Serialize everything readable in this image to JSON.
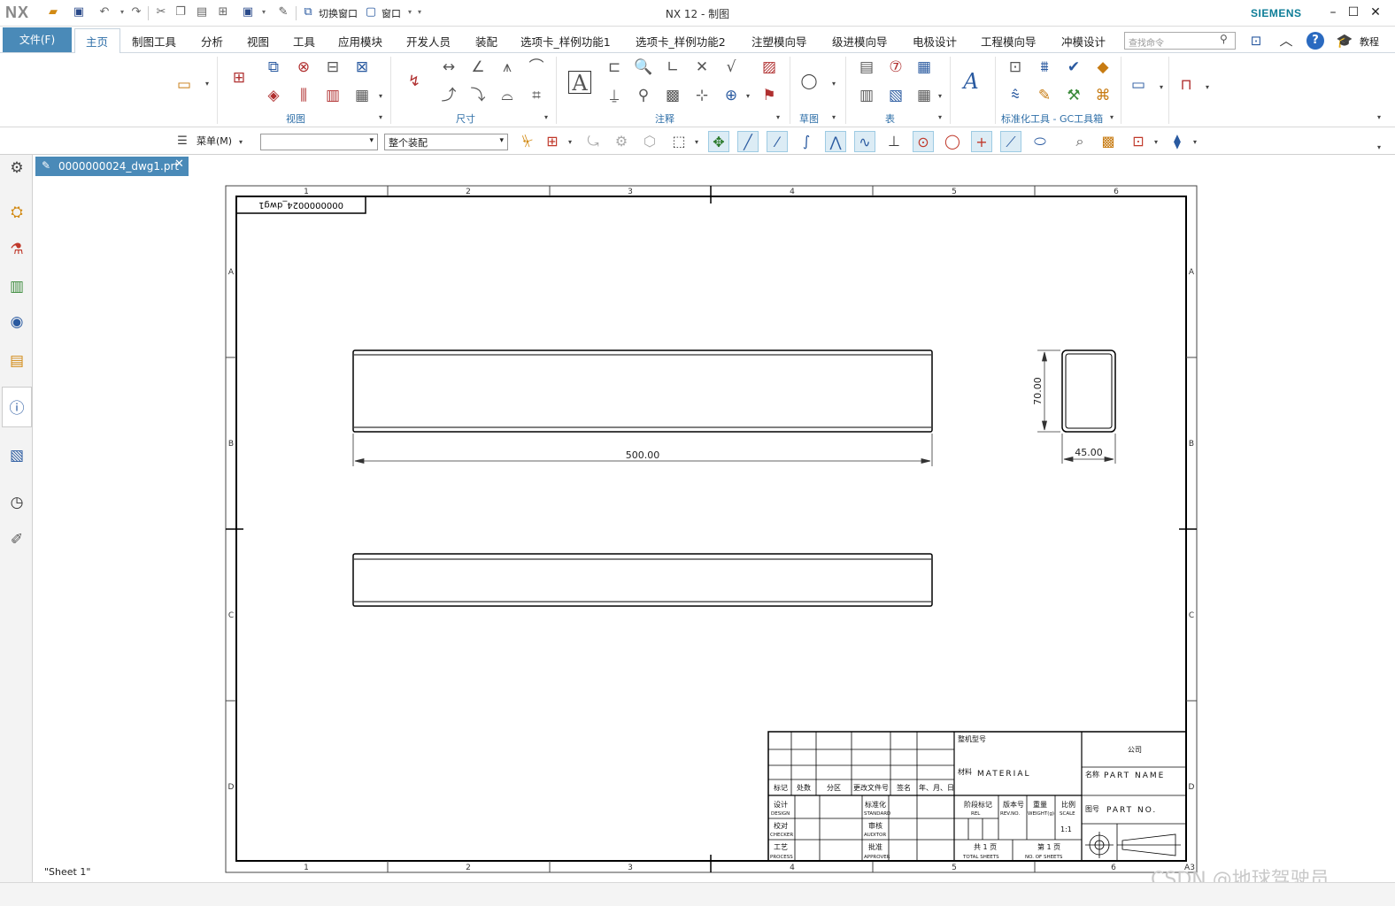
{
  "titlebar": {
    "logo": "NX",
    "switch_window": "切换窗口",
    "window_menu": "窗口",
    "app_title": "NX 12 - 制图",
    "brand": "SIEMENS"
  },
  "tabs": {
    "file": "文件(F)",
    "items": [
      "主页",
      "制图工具",
      "分析",
      "视图",
      "工具",
      "应用模块",
      "开发人员",
      "装配",
      "选项卡_样例功能1",
      "选项卡_样例功能2",
      "注塑模向导",
      "级进模向导",
      "电极设计",
      "工程模向导",
      "冲模设计"
    ],
    "search_placeholder": "查找命令",
    "tutorial": "教程"
  },
  "ribbon": {
    "groups": [
      "视图",
      "尺寸",
      "注释",
      "草图",
      "表",
      "标准化工具 - GC工具箱"
    ]
  },
  "selection_bar": {
    "menu": "菜单(M)",
    "filter_value": "",
    "scope_value": "整个装配"
  },
  "document": {
    "tab": "0000000024_dwg1.prt",
    "sheet_label": "\"Sheet 1\"",
    "watermark": "CSDN @地球驾驶员"
  },
  "drawing": {
    "corner_label": "0000000024_dwg1",
    "col_labels": [
      "1",
      "2",
      "3",
      "4",
      "5",
      "6"
    ],
    "row_labels": [
      "A",
      "B",
      "C",
      "D"
    ],
    "size_label": "A3",
    "dim_length": "500.00",
    "dim_height": "70.00",
    "dim_width": "45.00",
    "title_block": {
      "mark": "标记",
      "count": "处数",
      "zone": "分区",
      "change_doc": "更改文件号",
      "sign": "签名",
      "date": "年、月、日",
      "design": "设计",
      "design_en": "DESIGN",
      "checker": "校对",
      "checker_en": "CHECKER",
      "process": "工艺",
      "process_en": "PROCESS",
      "standard": "标准化",
      "standard_en": "STANDARD",
      "auditor": "审核",
      "auditor_en": "AUDITOR",
      "approver": "批准",
      "approver_en": "APPROVER",
      "model": "整机型号",
      "material": "材料",
      "material_en": "MATERIAL",
      "stage_mark": "阶段标记",
      "rel": "REL",
      "version": "版本号",
      "rev": "REV.NO.",
      "weight": "重量",
      "weight_en": "WEIGHT(g)",
      "scale": "比例",
      "scale_en": "SCALE",
      "scale_value": "1:1",
      "total": "共 1 页",
      "total_en": "TOTAL SHEETS",
      "sheet_no": "第 1 页",
      "sheet_no_en": "NO. OF SHEETS",
      "company": "公司",
      "name": "名称",
      "part_name": "PART NAME",
      "drawing_no": "图号",
      "part_no": "PART NO."
    }
  }
}
